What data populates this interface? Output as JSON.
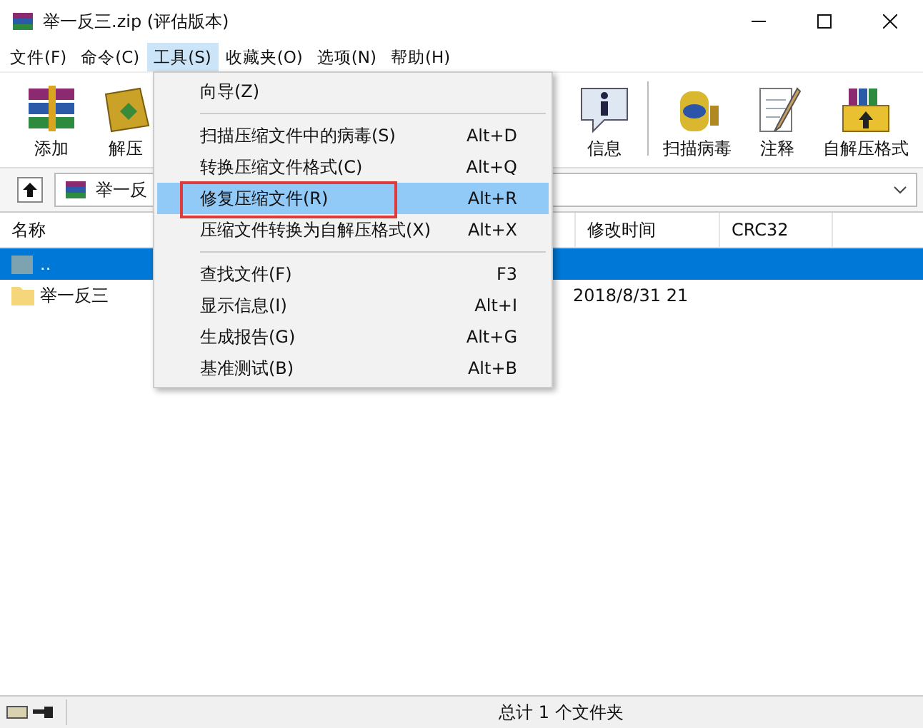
{
  "window": {
    "title": "举一反三.zip (评估版本)"
  },
  "menu_bar": [
    {
      "label": "文件(F)",
      "selected": false
    },
    {
      "label": "命令(C)",
      "selected": false
    },
    {
      "label": "工具(S)",
      "selected": true
    },
    {
      "label": "收藏夹(O)",
      "selected": false
    },
    {
      "label": "选项(N)",
      "selected": false
    },
    {
      "label": "帮助(H)",
      "selected": false
    }
  ],
  "toolbar_left": [
    {
      "label": "添加",
      "kind": "books"
    },
    {
      "label": "解压",
      "kind": "extract"
    }
  ],
  "toolbar_right": [
    {
      "label": "信息",
      "kind": "info"
    },
    {
      "label": "扫描病毒",
      "kind": "scan"
    },
    {
      "label": "注释",
      "kind": "comment"
    },
    {
      "label": "自解压格式",
      "kind": "sfx"
    }
  ],
  "address": {
    "value": "举一反"
  },
  "table": {
    "columns": [
      "名称",
      "修改时间",
      "CRC32"
    ],
    "rows": [
      {
        "kind": "parent",
        "name": "..",
        "selected": true
      },
      {
        "kind": "folder",
        "name": "举一反三",
        "modified": "2018/8/31 21",
        "selected": false
      }
    ]
  },
  "dropdown_menu": [
    {
      "kind": "item",
      "label": "向导(Z)",
      "selected": false,
      "annotated": false
    },
    {
      "kind": "separator"
    },
    {
      "kind": "item",
      "label": "扫描压缩文件中的病毒(S)",
      "shortcut": "Alt+D",
      "selected": false,
      "annotated": false
    },
    {
      "kind": "item",
      "label": "转换压缩文件格式(C)",
      "shortcut": "Alt+Q",
      "selected": false,
      "annotated": false
    },
    {
      "kind": "item",
      "label": "修复压缩文件(R)",
      "shortcut": "Alt+R",
      "selected": true,
      "annotated": true
    },
    {
      "kind": "item",
      "label": "压缩文件转换为自解压格式(X)",
      "shortcut": "Alt+X",
      "selected": false,
      "annotated": false
    },
    {
      "kind": "separator"
    },
    {
      "kind": "item",
      "label": "查找文件(F)",
      "shortcut": "F3",
      "selected": false,
      "annotated": false
    },
    {
      "kind": "item",
      "label": "显示信息(I)",
      "shortcut": "Alt+I",
      "selected": false,
      "annotated": false
    },
    {
      "kind": "item",
      "label": "生成报告(G)",
      "shortcut": "Alt+G",
      "selected": false,
      "annotated": false
    },
    {
      "kind": "item",
      "label": "基准测试(B)",
      "shortcut": "Alt+B",
      "selected": false,
      "annotated": false
    }
  ],
  "status_bar": {
    "text": "总计 1 个文件夹"
  }
}
